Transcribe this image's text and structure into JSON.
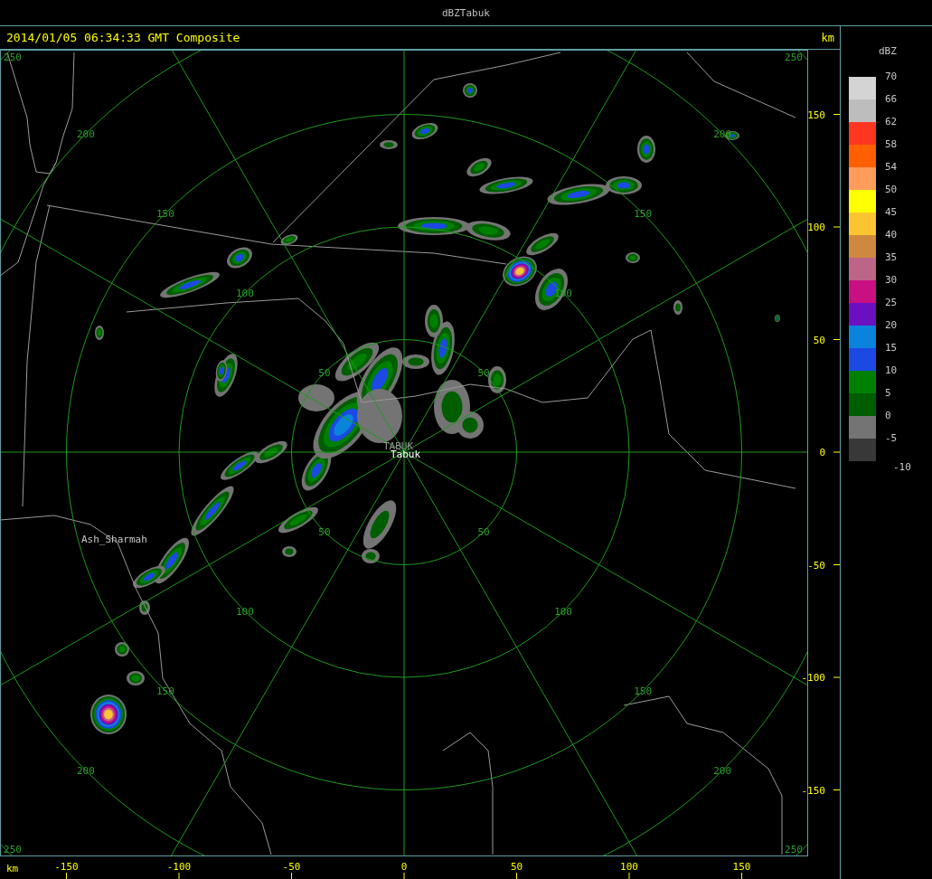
{
  "window": {
    "title": "dBZTabuk"
  },
  "header": {
    "timestamp": "2014/01/05 06:34:33 GMT Composite",
    "unit": "km"
  },
  "map": {
    "range_rings": [
      {
        "labels": [
          "50",
          "50",
          "50",
          "50"
        ]
      },
      {
        "labels": [
          "100",
          "100",
          "100",
          "100"
        ]
      },
      {
        "labels": [
          "150",
          "150",
          "150",
          "150"
        ]
      },
      {
        "labels": [
          "200",
          "200",
          "200",
          "200"
        ]
      },
      {
        "labels": [
          "250",
          "250",
          "250",
          "250"
        ]
      }
    ],
    "places": [
      {
        "name": "TABUK",
        "kind": "site"
      },
      {
        "name": "Tabuk",
        "kind": "city"
      },
      {
        "name": "Ash_Sharmah",
        "kind": "town"
      }
    ],
    "y_axis": {
      "ticks": [
        "150",
        "100",
        "50",
        "0",
        "-50",
        "-100",
        "-150"
      ]
    },
    "x_axis": {
      "unit": "km",
      "ticks": [
        "-150",
        "-100",
        "-50",
        "0",
        "50",
        "100",
        "150"
      ]
    }
  },
  "legend": {
    "title": "dBZ",
    "bins": [
      {
        "label": "70",
        "color": "#d4d4d4"
      },
      {
        "label": "66",
        "color": "#bdbdbd"
      },
      {
        "label": "62",
        "color": "#ff3720"
      },
      {
        "label": "58",
        "color": "#ff5f00"
      },
      {
        "label": "54",
        "color": "#ff9c5c"
      },
      {
        "label": "50",
        "color": "#ffff00"
      },
      {
        "label": "45",
        "color": "#fbc531"
      },
      {
        "label": "40",
        "color": "#cf883f"
      },
      {
        "label": "35",
        "color": "#bc6589"
      },
      {
        "label": "30",
        "color": "#c91083"
      },
      {
        "label": "25",
        "color": "#6a10c0"
      },
      {
        "label": "20",
        "color": "#0a83dc"
      },
      {
        "label": "15",
        "color": "#1c48e4"
      },
      {
        "label": "10",
        "color": "#008000"
      },
      {
        "label": "5",
        "color": "#005d00"
      },
      {
        "label": "0",
        "color": "#747474"
      },
      {
        "label": "-5",
        "color": "#383838"
      }
    ],
    "bottom_label": "-10"
  }
}
